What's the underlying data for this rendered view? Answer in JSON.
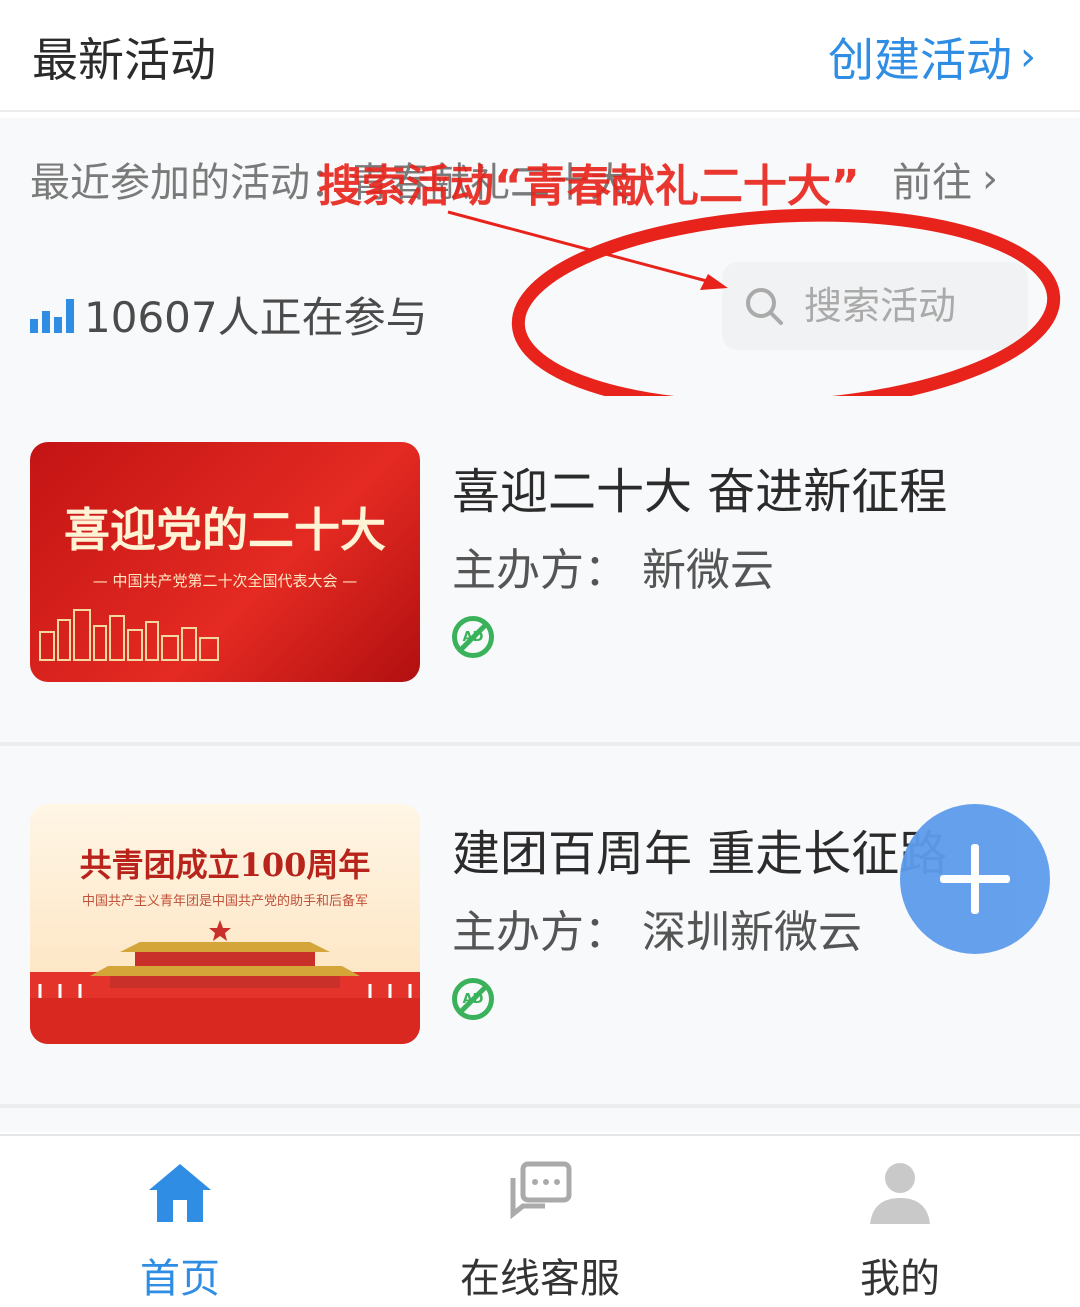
{
  "header": {
    "title": "最新活动",
    "create_label": "创建活动",
    "create_chevron": "›"
  },
  "recent": {
    "label": "最近参加的活动：青春献礼二十大",
    "go_label": "前往",
    "go_chevron": "›"
  },
  "stats": {
    "participants": "10607人正在参与"
  },
  "search": {
    "placeholder": "搜索活动"
  },
  "annotation": {
    "text": "搜索活动“青春献礼二十大”"
  },
  "activities": [
    {
      "title": "喜迎二十大 奋进新征程",
      "host": "主办方：  新微云",
      "image_title": "喜迎党的二十大",
      "image_subtitle": "— 中国共产党第二十次全国代表大会 —",
      "badge": "AD"
    },
    {
      "title": "建团百周年 重走长征路",
      "host": "主办方：  深圳新微云",
      "image_title": "共青团成立100周年",
      "image_subtitle": "中国共产主义青年团是中国共产党的助手和后备军",
      "badge": "AD"
    }
  ],
  "tabs": [
    {
      "label": "首页",
      "icon": "home-icon",
      "active": true
    },
    {
      "label": "在线客服",
      "icon": "chat-icon",
      "active": false
    },
    {
      "label": "我的",
      "icon": "user-icon",
      "active": false
    }
  ],
  "colors": {
    "accent": "#2f8de4",
    "annotation": "#e8231b",
    "fab": "#5d9cec",
    "ad_badge": "#39b25b"
  }
}
